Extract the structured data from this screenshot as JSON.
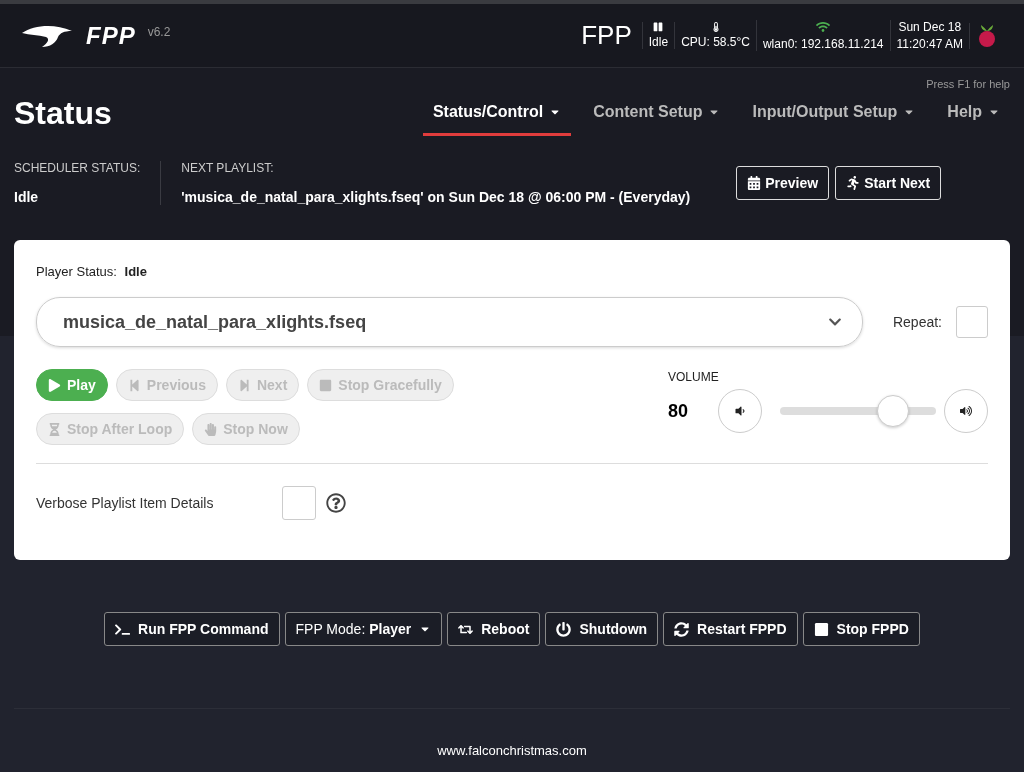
{
  "header": {
    "logo_text": "FPP",
    "version": "v6.2",
    "host": "FPP",
    "status": "Idle",
    "cpu": "CPU: 58.5°C",
    "network": "wlan0: 192.168.11.214",
    "date": "Sun Dec 18",
    "time": "11:20:47 AM"
  },
  "help_hint": "Press F1 for help",
  "page_title": "Status",
  "nav": [
    {
      "label": "Status/Control",
      "selected": true
    },
    {
      "label": "Content Setup",
      "selected": false
    },
    {
      "label": "Input/Output Setup",
      "selected": false
    },
    {
      "label": "Help",
      "selected": false
    }
  ],
  "scheduler": {
    "status_label": "SCHEDULER STATUS:",
    "status": "Idle",
    "next_label": "NEXT PLAYLIST:",
    "next": "'musica_de_natal_para_xlights.fseq' on Sun Dec 18 @ 06:00 PM - (Everyday)",
    "buttons": [
      {
        "kind": "calendar",
        "label": "Preview"
      },
      {
        "kind": "run",
        "label": "Start Next"
      }
    ]
  },
  "player": {
    "status_label": "Player Status:",
    "status": "Idle",
    "playlist": "musica_de_natal_para_xlights.fseq",
    "repeat_label": "Repeat:",
    "repeat_checked": false,
    "controls": [
      {
        "kind": "play",
        "label": "Play",
        "disabled": false
      },
      {
        "kind": "previous",
        "label": "Previous",
        "disabled": true
      },
      {
        "kind": "next",
        "label": "Next",
        "disabled": true
      },
      {
        "kind": "stop",
        "label": "Stop Gracefully",
        "disabled": true
      },
      {
        "kind": "hourglass",
        "label": "Stop After Loop",
        "disabled": true
      },
      {
        "kind": "hand",
        "label": "Stop Now",
        "disabled": true
      }
    ],
    "volume": {
      "label": "VOLUME",
      "reading": "80",
      "level": 0.72
    },
    "verbose_label": "Verbose Playlist Item Details",
    "verbose_checked": false
  },
  "actions": [
    {
      "kind": "terminal",
      "label": "Run FPP Command"
    },
    {
      "kind": "mode",
      "prefix": "FPP Mode:",
      "label": "Player"
    },
    {
      "kind": "reboot",
      "label": "Reboot"
    },
    {
      "kind": "power",
      "label": "Shutdown"
    },
    {
      "kind": "restart",
      "label": "Restart FPPD"
    },
    {
      "kind": "square",
      "label": "Stop FPPD"
    }
  ],
  "footer": "www.falconchristmas.com"
}
